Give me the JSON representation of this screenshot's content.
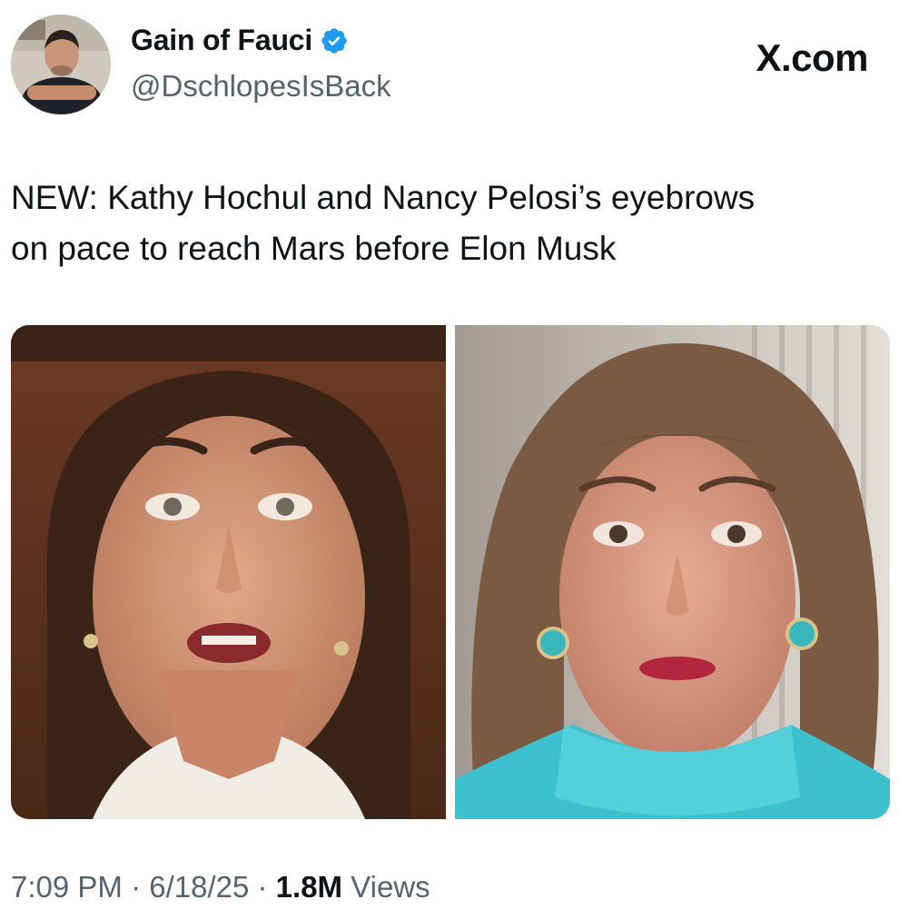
{
  "author": {
    "display_name": "Gain of Fauci",
    "handle": "@DschlopesIsBack",
    "avatar_icon": "profile-photo",
    "verified_icon": "verified-badge-icon",
    "verified_color": "#1d9bf0"
  },
  "brand": {
    "label": "X.com"
  },
  "tweet": {
    "text": "NEW: Kathy Hochul and Nancy Pelosi’s eyebrows\non pace to reach Mars before Elon Musk"
  },
  "media": {
    "count": 2
  },
  "meta": {
    "time": "7:09 PM",
    "sep1": " · ",
    "date": "6/18/25",
    "sep2": " · ",
    "views_count": "1.8M",
    "views_label": " Views"
  },
  "colors": {
    "text_primary": "#0f1419",
    "text_secondary": "#536471",
    "accent": "#1d9bf0"
  }
}
